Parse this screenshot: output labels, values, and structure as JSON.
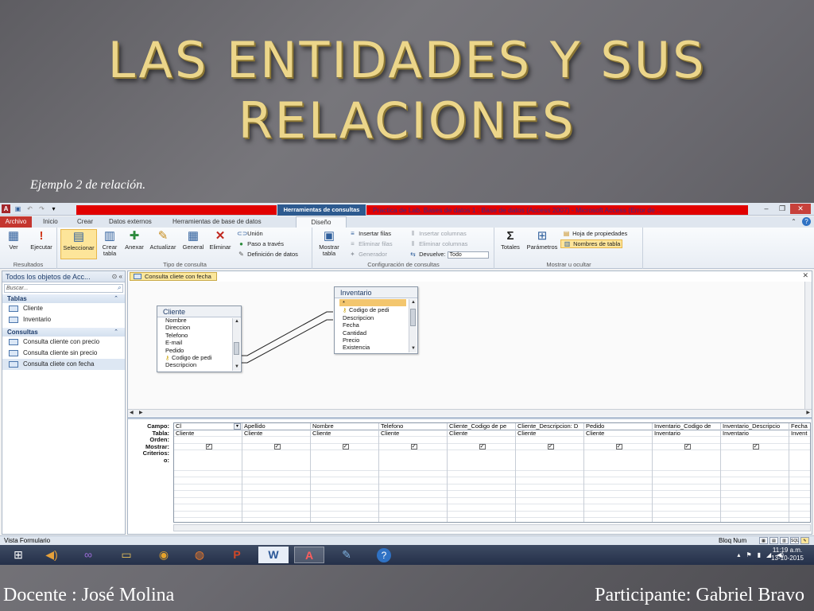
{
  "slide": {
    "title_line1": "LAS ENTIDADES Y SUS",
    "title_line2": "RELACIONES",
    "subtitle": "Ejemplo 2 de relación.",
    "docente": "Docente : José Molina",
    "participante": "Participante: Gabriel Bravo"
  },
  "window": {
    "context_tab": "Herramientas de consultas",
    "title": "Practica de Lab. Bases de datos 1 : Base de datos (Access 2007) - Microsoft Access (Error de ..."
  },
  "tabs": {
    "file": "Archivo",
    "items": [
      "Inicio",
      "Crear",
      "Datos externos",
      "Herramientas de base de datos",
      "Diseño"
    ]
  },
  "ribbon": {
    "resultados": {
      "label": "Resultados",
      "ver": "Ver",
      "ejecutar": "Ejecutar"
    },
    "tipo": {
      "label": "Tipo de consulta",
      "seleccionar": "Seleccionar",
      "crear_tabla_1": "Crear",
      "crear_tabla_2": "tabla",
      "anexar": "Anexar",
      "actualizar": "Actualizar",
      "general": "General",
      "eliminar": "Eliminar",
      "union": "Unión",
      "paso": "Paso a través",
      "definicion": "Definición de datos"
    },
    "config": {
      "label": "Configuración de consultas",
      "mostrar_tabla_1": "Mostrar",
      "mostrar_tabla_2": "tabla",
      "insertar_filas": "Insertar filas",
      "eliminar_filas": "Eliminar filas",
      "generador": "Generador",
      "insertar_columnas": "Insertar columnas",
      "eliminar_columnas": "Eliminar columnas",
      "devuelve": "Devuelve:",
      "devuelve_value": "Todo"
    },
    "mostrar": {
      "label": "Mostrar u ocultar",
      "totales": "Totales",
      "parametros": "Parámetros",
      "hoja": "Hoja de propiedades",
      "nombres": "Nombres de tabla"
    }
  },
  "nav": {
    "header": "Todos los objetos de Acc...",
    "search_placeholder": "Buscar...",
    "section_tablas": "Tablas",
    "tablas": [
      "Cliente",
      "Inventario"
    ],
    "section_consultas": "Consultas",
    "consultas": [
      "Consulta cliente con precio",
      "Consulta cliente sin precio",
      "Consulta cliete con fecha"
    ]
  },
  "doc": {
    "tab": "Consulta cliete con fecha"
  },
  "tables": {
    "cliente": {
      "name": "Cliente",
      "fields": [
        "Nombre",
        "Direccion",
        "Telefono",
        "E-mail",
        "Pedido",
        "Codigo de pedi",
        "Descripcion"
      ]
    },
    "inventario": {
      "name": "Inventario",
      "fields": [
        "*",
        "Codigo de pedi",
        "Descripcion",
        "Fecha",
        "Cantidad",
        "Precio",
        "Existencia"
      ]
    }
  },
  "grid": {
    "row_labels": [
      "Campo:",
      "Tabla:",
      "Orden:",
      "Mostrar:",
      "Criterios:",
      "o:"
    ],
    "columns": [
      {
        "campo": "Cl",
        "tabla": "Cliente"
      },
      {
        "campo": "Apellido",
        "tabla": "Cliente"
      },
      {
        "campo": "Nombre",
        "tabla": "Cliente"
      },
      {
        "campo": "Telefono",
        "tabla": "Cliente"
      },
      {
        "campo": "Cliente_Codigo de pe",
        "tabla": "Cliente"
      },
      {
        "campo": "Cliente_Descripcion: D",
        "tabla": "Cliente"
      },
      {
        "campo": "Pedido",
        "tabla": "Cliente"
      },
      {
        "campo": "Inventario_Codigo de",
        "tabla": "Inventario"
      },
      {
        "campo": "Inventario_Descripcio",
        "tabla": "Inventario"
      },
      {
        "campo": "Fecha",
        "tabla": "Invent"
      }
    ]
  },
  "status": {
    "left": "Vista Formulario",
    "right": "Bloq Num",
    "views": [
      "SQL"
    ]
  },
  "taskbar": {
    "time": "11:19 a.m.",
    "date": "13-10-2015"
  }
}
